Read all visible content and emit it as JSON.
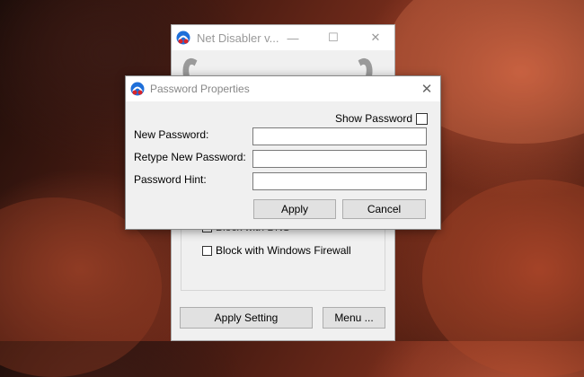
{
  "main_window": {
    "title": "Net Disabler v...",
    "partial_option_label": "Block with DNS",
    "firewall_option_label": "Block with Windows Firewall",
    "apply_setting_label": "Apply Setting",
    "menu_label": "Menu ...",
    "titlebar_buttons": {
      "minimize": "—",
      "maximize": "☐",
      "close": "✕"
    }
  },
  "dialog": {
    "title": "Password Properties",
    "close_glyph": "✕",
    "show_password_label": "Show Password",
    "fields": [
      {
        "label": "New Password:",
        "value": ""
      },
      {
        "label": "Retype New Password:",
        "value": ""
      },
      {
        "label": "Password Hint:",
        "value": ""
      }
    ],
    "apply_label": "Apply",
    "cancel_label": "Cancel"
  },
  "icons": {
    "app_icon": "net-disabler-app-icon"
  },
  "colors": {
    "accent_blue": "#1e6fd9",
    "accent_red": "#d8242a",
    "window_bg": "#f0f0f0"
  }
}
